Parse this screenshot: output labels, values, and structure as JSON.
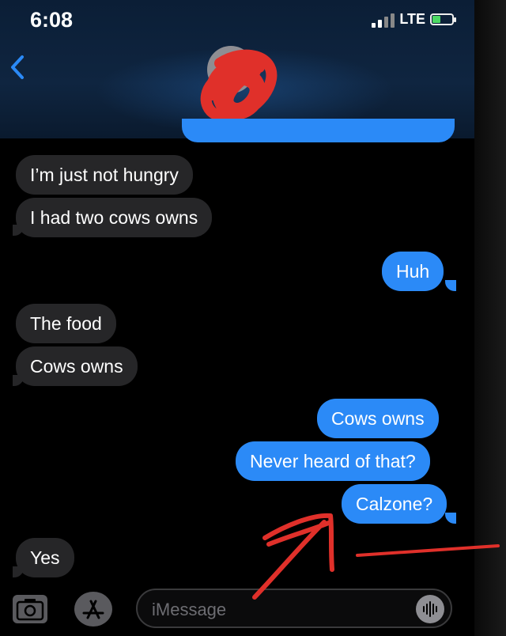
{
  "status_bar": {
    "time": "6:08",
    "network": "LTE",
    "battery_icon": "battery-charging-icon"
  },
  "header": {
    "back_icon": "chevron-left-icon",
    "accent_color": "#2b8af7"
  },
  "messages": [
    {
      "side": "incoming",
      "text": "I’m just not hungry"
    },
    {
      "side": "incoming",
      "text": "I had two cows owns"
    },
    {
      "side": "outgoing",
      "text": "Huh"
    },
    {
      "side": "incoming",
      "text": "The food"
    },
    {
      "side": "incoming",
      "text": "Cows owns"
    },
    {
      "side": "outgoing",
      "text": "Cows owns"
    },
    {
      "side": "outgoing",
      "text": "Never heard of that?"
    },
    {
      "side": "outgoing",
      "text": "Calzone?"
    },
    {
      "side": "incoming",
      "text": "Yes"
    }
  ],
  "compose_bar": {
    "camera_icon": "camera-icon",
    "apps_icon": "app-store-icon",
    "placeholder": "iMessage",
    "audio_icon": "audio-waveform-icon"
  },
  "colors": {
    "incoming_bubble": "#262628",
    "outgoing_bubble": "#2b8af7",
    "annotation_red": "#e0302a"
  }
}
